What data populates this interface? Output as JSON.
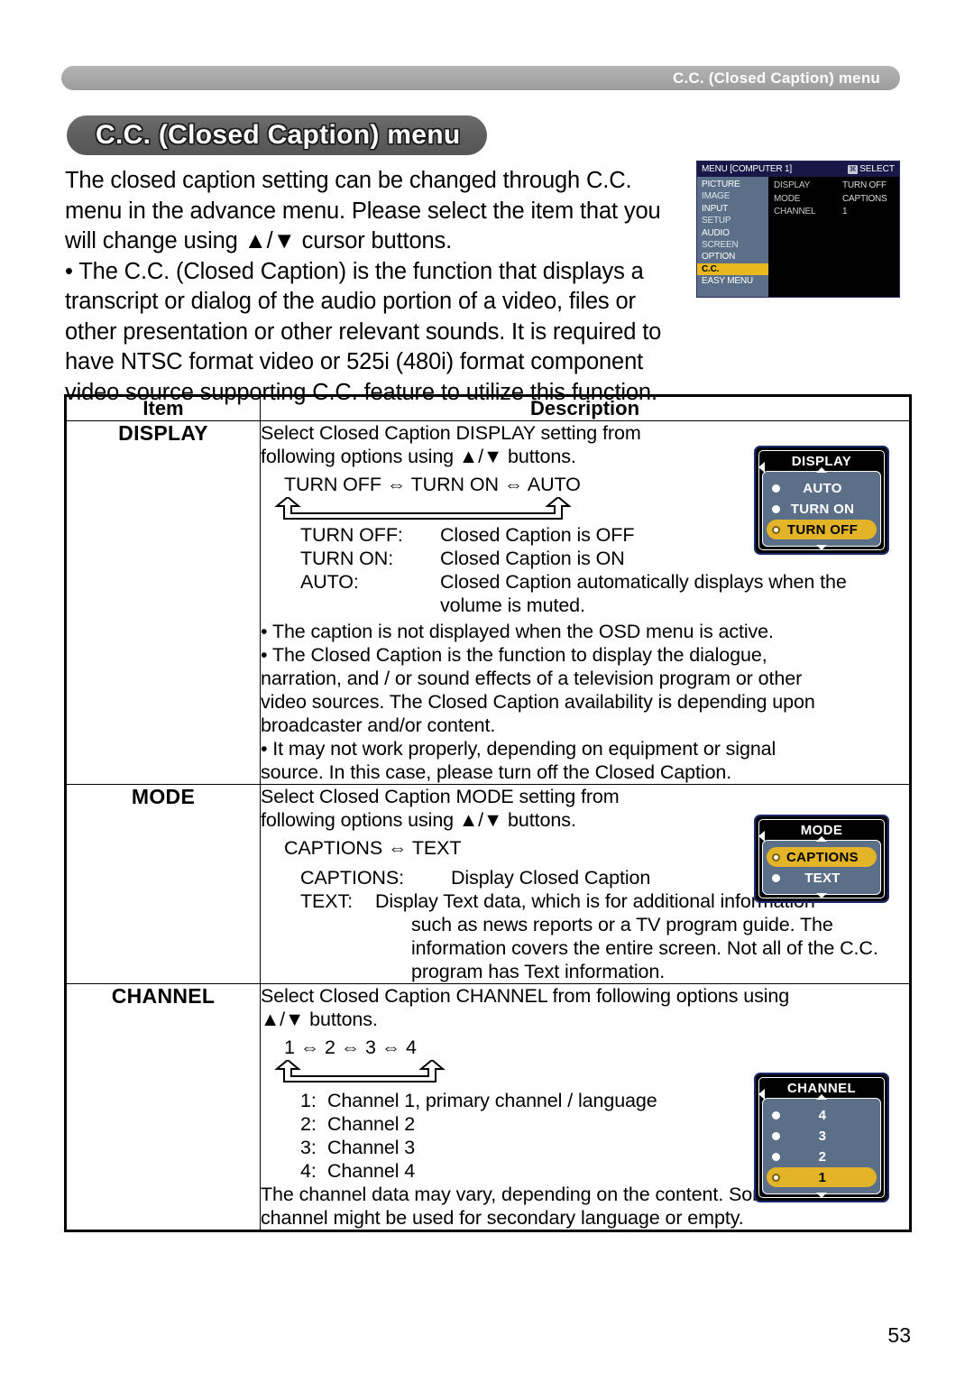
{
  "running_header": {
    "text": "C.C. (Closed Caption) menu"
  },
  "page_title": {
    "text": "C.C. (Closed Caption) menu"
  },
  "intro": {
    "line1": "The closed caption setting can be changed through C.C.",
    "line2": "menu in the advance menu. Please select the item that you",
    "line3": "will change using ▲/▼ cursor buttons.",
    "line4": "• The C.C. (Closed Caption) is the function that displays a",
    "line5": "transcript or dialog of the audio portion of a video, files or",
    "line6": "other presentation or other relevant sounds. It is required to",
    "line7": "have NTSC format video or 525i (480i) format component",
    "line8": "video source supporting C.C. feature to utilize this function."
  },
  "osd": {
    "title_left": "MENU [COMPUTER 1]",
    "select_badge": "⌘",
    "title_right": "SELECT",
    "sidebar": [
      {
        "label": "PICTURE",
        "active": false
      },
      {
        "label": "IMAGE",
        "active": false
      },
      {
        "label": "INPUT",
        "active": false
      },
      {
        "label": "SETUP",
        "active": false
      },
      {
        "label": "AUDIO",
        "active": false
      },
      {
        "label": "SCREEN",
        "active": false
      },
      {
        "label": "OPTION",
        "active": false
      },
      {
        "label": "C.C.",
        "active": true
      },
      {
        "label": "EASY MENU",
        "active": false
      }
    ],
    "rows": [
      {
        "label": "DISPLAY",
        "value": "TURN OFF"
      },
      {
        "label": "MODE",
        "value": "CAPTIONS"
      },
      {
        "label": "CHANNEL",
        "value": "1"
      }
    ]
  },
  "table": {
    "headers": {
      "item": "Item",
      "description": "Description"
    },
    "rows": [
      {
        "item": "DISPLAY",
        "intro_l1": "Select Closed Caption DISPLAY setting from",
        "intro_l2": "following options using ▲/▼ buttons.",
        "options_chain": "TURN OFF ⇔ TURN ON ⇔ AUTO",
        "defs": [
          {
            "key": "TURN OFF:",
            "val": "Closed Caption is OFF"
          },
          {
            "key": "TURN ON:",
            "val": "Closed Caption is ON"
          },
          {
            "key": "AUTO:",
            "val": "Closed Caption automatically displays when the"
          }
        ],
        "def_cont": "volume is muted.",
        "bullets": [
          "• The caption is not displayed when the OSD menu is active.",
          "• The Closed Caption is the function to display the dialogue,",
          "narration, and / or sound effects of a television program or other",
          "video sources. The Closed Caption availability is depending upon",
          "broadcaster and/or content.",
          "• It may not work properly, depending on equipment or signal",
          "source. In this case, please turn off the Closed Caption."
        ]
      },
      {
        "item": "MODE",
        "intro_l1": "Select Closed Caption MODE setting from",
        "intro_l2": "following options using ▲/▼ buttons.",
        "options_chain": "CAPTIONS ⇔ TEXT",
        "defs": [
          {
            "key": "CAPTIONS:",
            "val": "Display Closed Caption"
          },
          {
            "key": "TEXT:",
            "val": "Display Text data, which is for additional information"
          }
        ],
        "def_cont_lines": [
          "such as news reports or a TV program guide. The",
          "information covers the entire screen. Not all of the C.C.",
          "program has Text information."
        ]
      },
      {
        "item": "CHANNEL",
        "intro_l1": "Select Closed Caption CHANNEL from following options using",
        "intro_l2": "▲/▼ buttons.",
        "options_chain": "1 ⇔ 2 ⇔ 3 ⇔ 4",
        "defs": [
          {
            "key": "1:",
            "val": "Channel 1, primary channel / language"
          },
          {
            "key": "2:",
            "val": "Channel 2"
          },
          {
            "key": "3:",
            "val": "Channel 3"
          },
          {
            "key": "4:",
            "val": "Channel 4"
          }
        ],
        "tail_l1": "The channel data may vary, depending on the content. Some",
        "tail_l2": "channel might be used for secondary language or empty."
      }
    ]
  },
  "popups": {
    "display": {
      "title": "DISPLAY",
      "items": [
        {
          "label": "AUTO",
          "selected": false
        },
        {
          "label": "TURN ON",
          "selected": false
        },
        {
          "label": "TURN OFF",
          "selected": true
        }
      ]
    },
    "mode": {
      "title": "MODE",
      "items": [
        {
          "label": "CAPTIONS",
          "selected": true
        },
        {
          "label": "TEXT",
          "selected": false
        }
      ]
    },
    "channel": {
      "title": "CHANNEL",
      "items": [
        {
          "label": "4",
          "selected": false
        },
        {
          "label": "3",
          "selected": false
        },
        {
          "label": "2",
          "selected": false
        },
        {
          "label": "1",
          "selected": true
        }
      ]
    }
  },
  "footer": {
    "page_number": "53"
  },
  "colors": {
    "osd_accent": "#e8b81e",
    "osd_sidebar": "#5b7088",
    "osd_titlebar": "#181848",
    "popup_border": "#1d2a6b",
    "popup_selected": "#e3b427",
    "header_bar": "#a8a8a8",
    "title_pill": "#5e5e5e"
  }
}
